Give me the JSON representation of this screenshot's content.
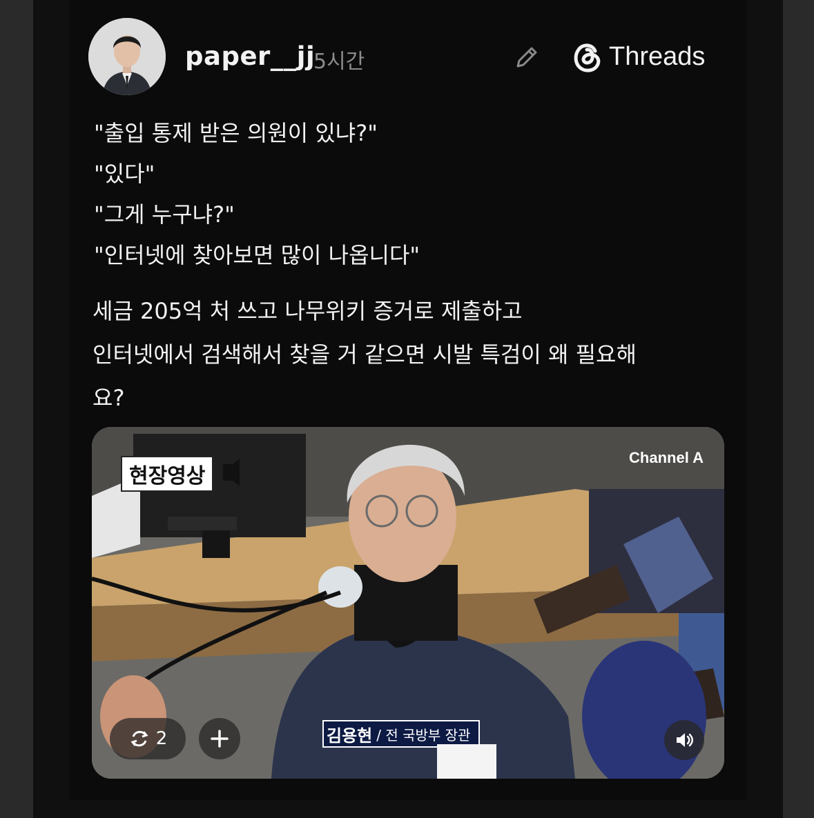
{
  "post": {
    "username": "paper__jj",
    "time": "5시간",
    "brand": "Threads",
    "quotes": [
      "\"출입 통제 받은 의원이 있냐?\"",
      "\"있다\"",
      "\"그게 누구냐?\"",
      "\"인터넷에 찾아보면 많이 나옵니다\""
    ],
    "body_lines": [
      "세금 205억 처 쓰고 나무위키 증거로 제출하고",
      "인터넷에서 검색해서 찾을 거 같으면 시발 특검이 왜 필요해",
      "요?"
    ]
  },
  "video": {
    "live_badge": "현장영상",
    "channel": "Channel A",
    "caption_name": "김용현",
    "caption_title": "/ 전 국방부 장관",
    "repost_count": "2"
  },
  "icons": {
    "edit": "pencil-icon",
    "threads": "threads-logo-icon",
    "repost": "repost-icon",
    "plus": "plus-icon",
    "sound": "speaker-icon"
  }
}
